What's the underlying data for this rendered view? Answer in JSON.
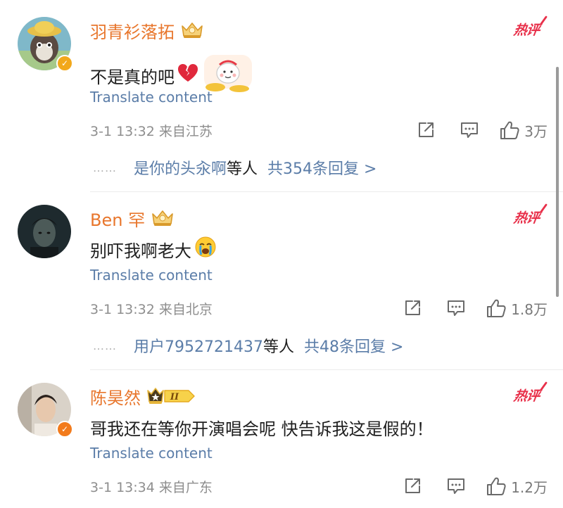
{
  "ui": {
    "translate_label": "Translate content",
    "hot_badge_label": "热评",
    "reply_dots": "……"
  },
  "colors": {
    "username": "#e8762c",
    "link": "#5b7da8",
    "hot_badge": "#e8304a",
    "meta": "#8e8e8e",
    "verified_gold": "#f2a81b",
    "verified_orange": "#f27b1c"
  },
  "comments": [
    {
      "username": "羽青衫落拓",
      "badge_icon": "crown-badge-icon",
      "text": "不是真的吧",
      "emoji": "broken-heart-icon",
      "time_location": "3-1 13:32 来自江苏",
      "likes": "3万",
      "verified": "gold",
      "reply_users": "是你的头汆啊",
      "reply_suffix": "等人",
      "reply_total": "共354条回复 >"
    },
    {
      "username": "Ben 罕",
      "badge_icon": "crown-badge-icon",
      "text": "别吓我啊老大",
      "emoji": "crying-face-icon",
      "time_location": "3-1 13:32 来自北京",
      "likes": "1.8万",
      "reply_users": "用户7952721437",
      "reply_suffix": "等人",
      "reply_total": "共48条回复 >"
    },
    {
      "username": "陈昊然",
      "badge_icon": "crown-level-badge-icon",
      "badge_level": "II",
      "text": "哥我还在等你开演唱会呢 快告诉我这是假的！",
      "time_location": "3-1 13:34 来自广东",
      "likes": "1.2万",
      "verified": "orange"
    }
  ]
}
